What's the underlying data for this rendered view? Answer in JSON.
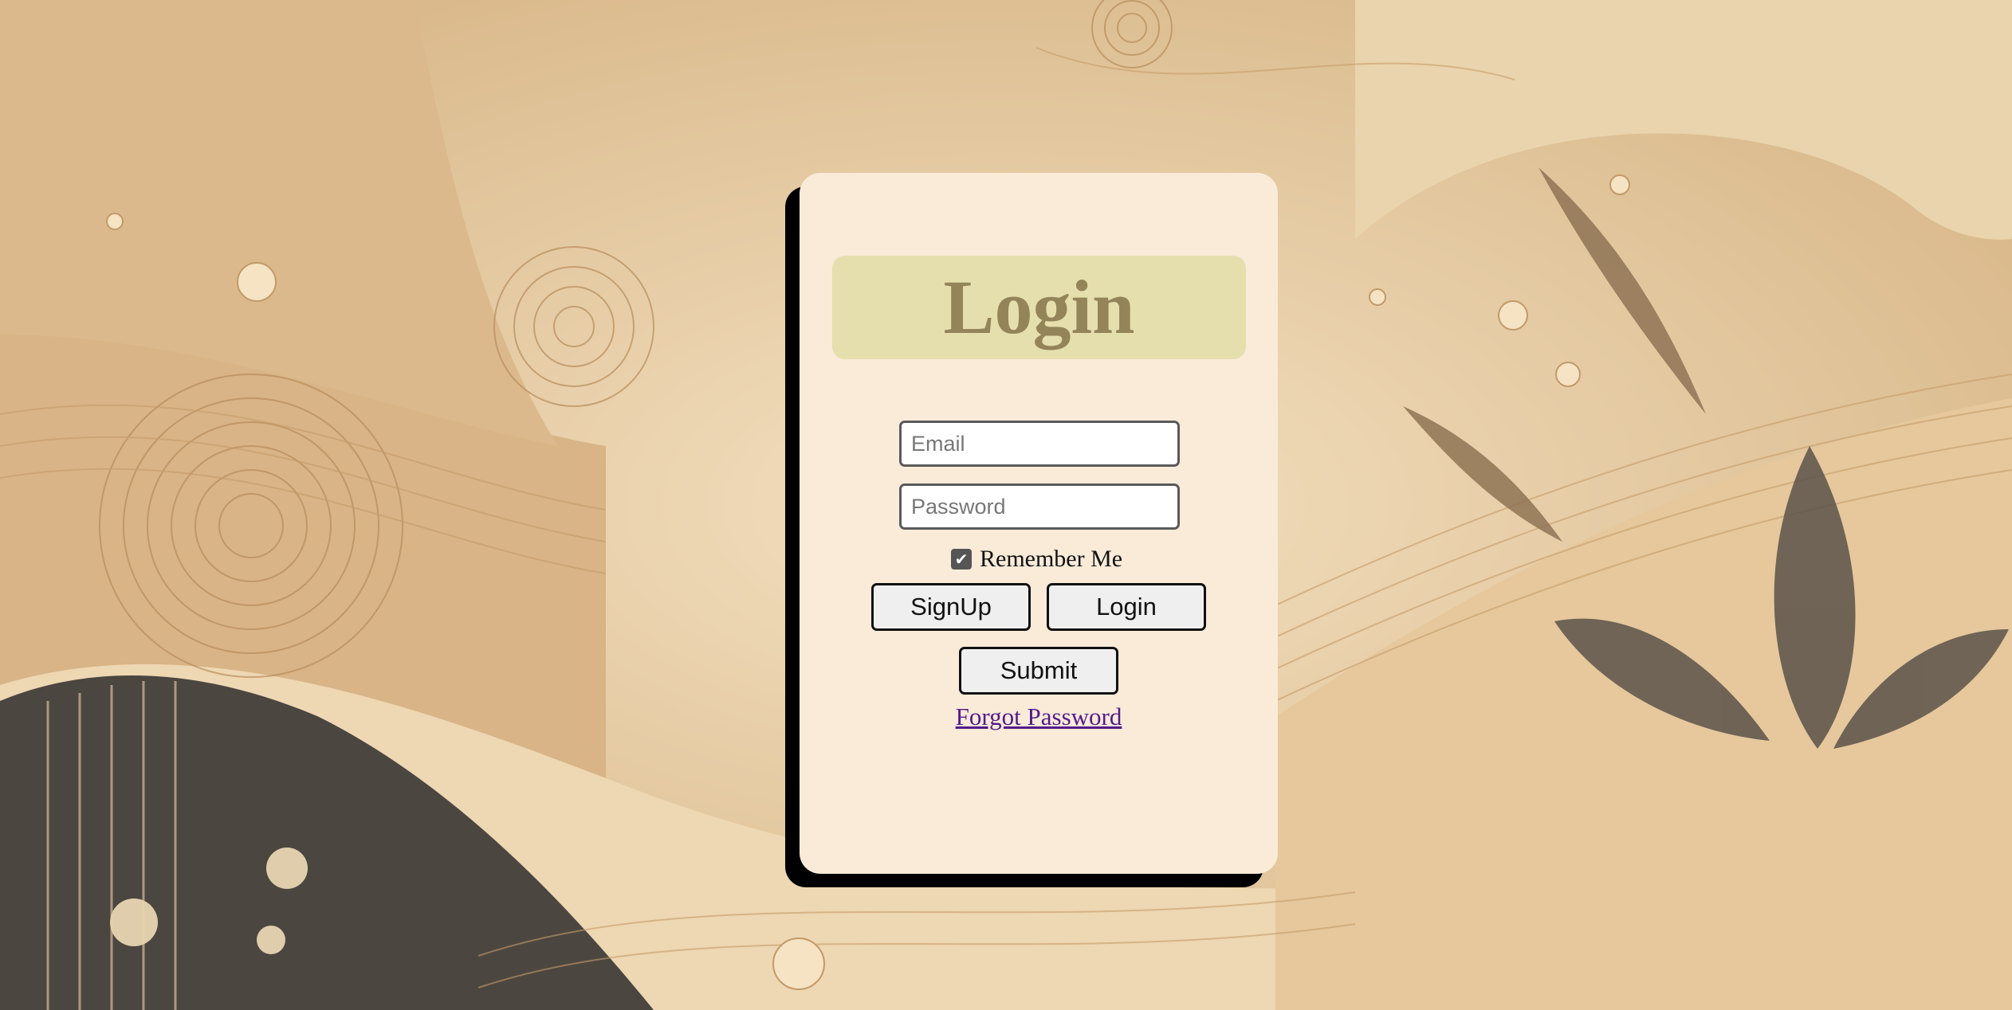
{
  "login_card": {
    "title": "Login",
    "email_placeholder": "Email",
    "password_placeholder": "Password",
    "remember_label": "Remember Me",
    "remember_checked": true,
    "signup_label": "SignUp",
    "login_label": "Login",
    "submit_label": "Submit",
    "forgot_label": "Forgot Password"
  },
  "colors": {
    "card_background": "#f9ebd8",
    "title_box": "#e5dfad",
    "title_text": "#938459",
    "link": "#551a8b",
    "page_background": "#e7cfa8"
  },
  "icons": {
    "remember_checkbox": "checkmark-icon"
  }
}
